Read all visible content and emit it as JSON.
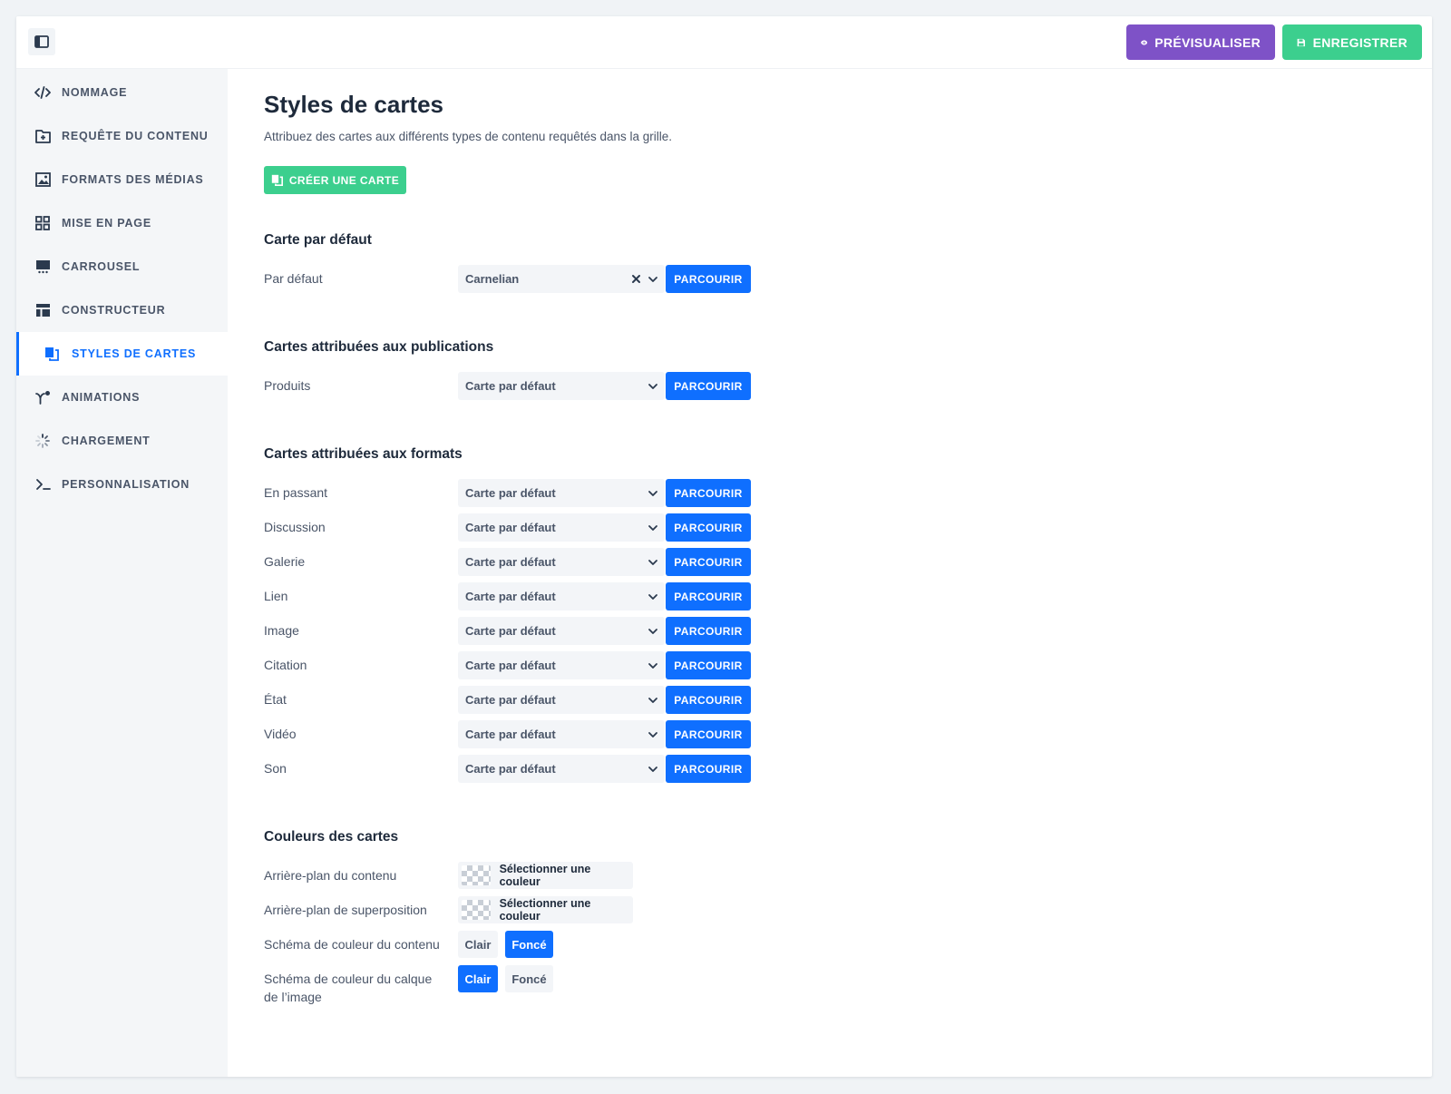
{
  "toolbar": {
    "preview_label": "PRÉVISUALISER",
    "save_label": "ENREGISTRER",
    "colors": {
      "preview": "#7e52c7",
      "save": "#3ccf8e"
    }
  },
  "sidebar": {
    "items": [
      {
        "label": "NOMMAGE",
        "icon": "code-icon"
      },
      {
        "label": "REQUÊTE DU CONTENU",
        "icon": "folder-plus-icon"
      },
      {
        "label": "FORMATS DES MÉDIAS",
        "icon": "image-icon"
      },
      {
        "label": "MISE EN PAGE",
        "icon": "grid-icon"
      },
      {
        "label": "CARROUSEL",
        "icon": "carousel-icon"
      },
      {
        "label": "CONSTRUCTEUR",
        "icon": "layout-icon"
      },
      {
        "label": "STYLES DE CARTES",
        "icon": "cards-icon",
        "active": true
      },
      {
        "label": "ANIMATIONS",
        "icon": "animation-icon"
      },
      {
        "label": "CHARGEMENT",
        "icon": "spinner-icon"
      },
      {
        "label": "PERSONNALISATION",
        "icon": "terminal-icon"
      }
    ]
  },
  "main": {
    "title": "Styles de cartes",
    "description": "Attribuez des cartes aux différents types de contenu requêtés dans la grille.",
    "create_label": "CRÉER UNE CARTE",
    "browse_label": "PARCOURIR",
    "default_section": {
      "title": "Carte par défaut",
      "label": "Par défaut",
      "value": "Carnelian"
    },
    "posts_section": {
      "title": "Cartes attribuées aux publications",
      "rows": [
        {
          "label": "Produits",
          "value": "Carte par défaut"
        }
      ]
    },
    "formats_section": {
      "title": "Cartes attribuées aux formats",
      "rows": [
        {
          "label": "En passant",
          "value": "Carte par défaut"
        },
        {
          "label": "Discussion",
          "value": "Carte par défaut"
        },
        {
          "label": "Galerie",
          "value": "Carte par défaut"
        },
        {
          "label": "Lien",
          "value": "Carte par défaut"
        },
        {
          "label": "Image",
          "value": "Carte par défaut"
        },
        {
          "label": "Citation",
          "value": "Carte par défaut"
        },
        {
          "label": "État",
          "value": "Carte par défaut"
        },
        {
          "label": "Vidéo",
          "value": "Carte par défaut"
        },
        {
          "label": "Son",
          "value": "Carte par défaut"
        }
      ]
    },
    "colors_section": {
      "title": "Couleurs des cartes",
      "content_bg_label": "Arrière-plan du contenu",
      "overlay_bg_label": "Arrière-plan de superposition",
      "pick_color_label": "Sélectionner une couleur",
      "content_scheme_label": "Schéma de couleur du contenu",
      "overlay_scheme_label": "Schéma de couleur du calque de l’image",
      "light_label": "Clair",
      "dark_label": "Foncé",
      "content_scheme_selected": "Foncé",
      "overlay_scheme_selected": "Clair"
    },
    "accent_color": "#0f6fff"
  }
}
